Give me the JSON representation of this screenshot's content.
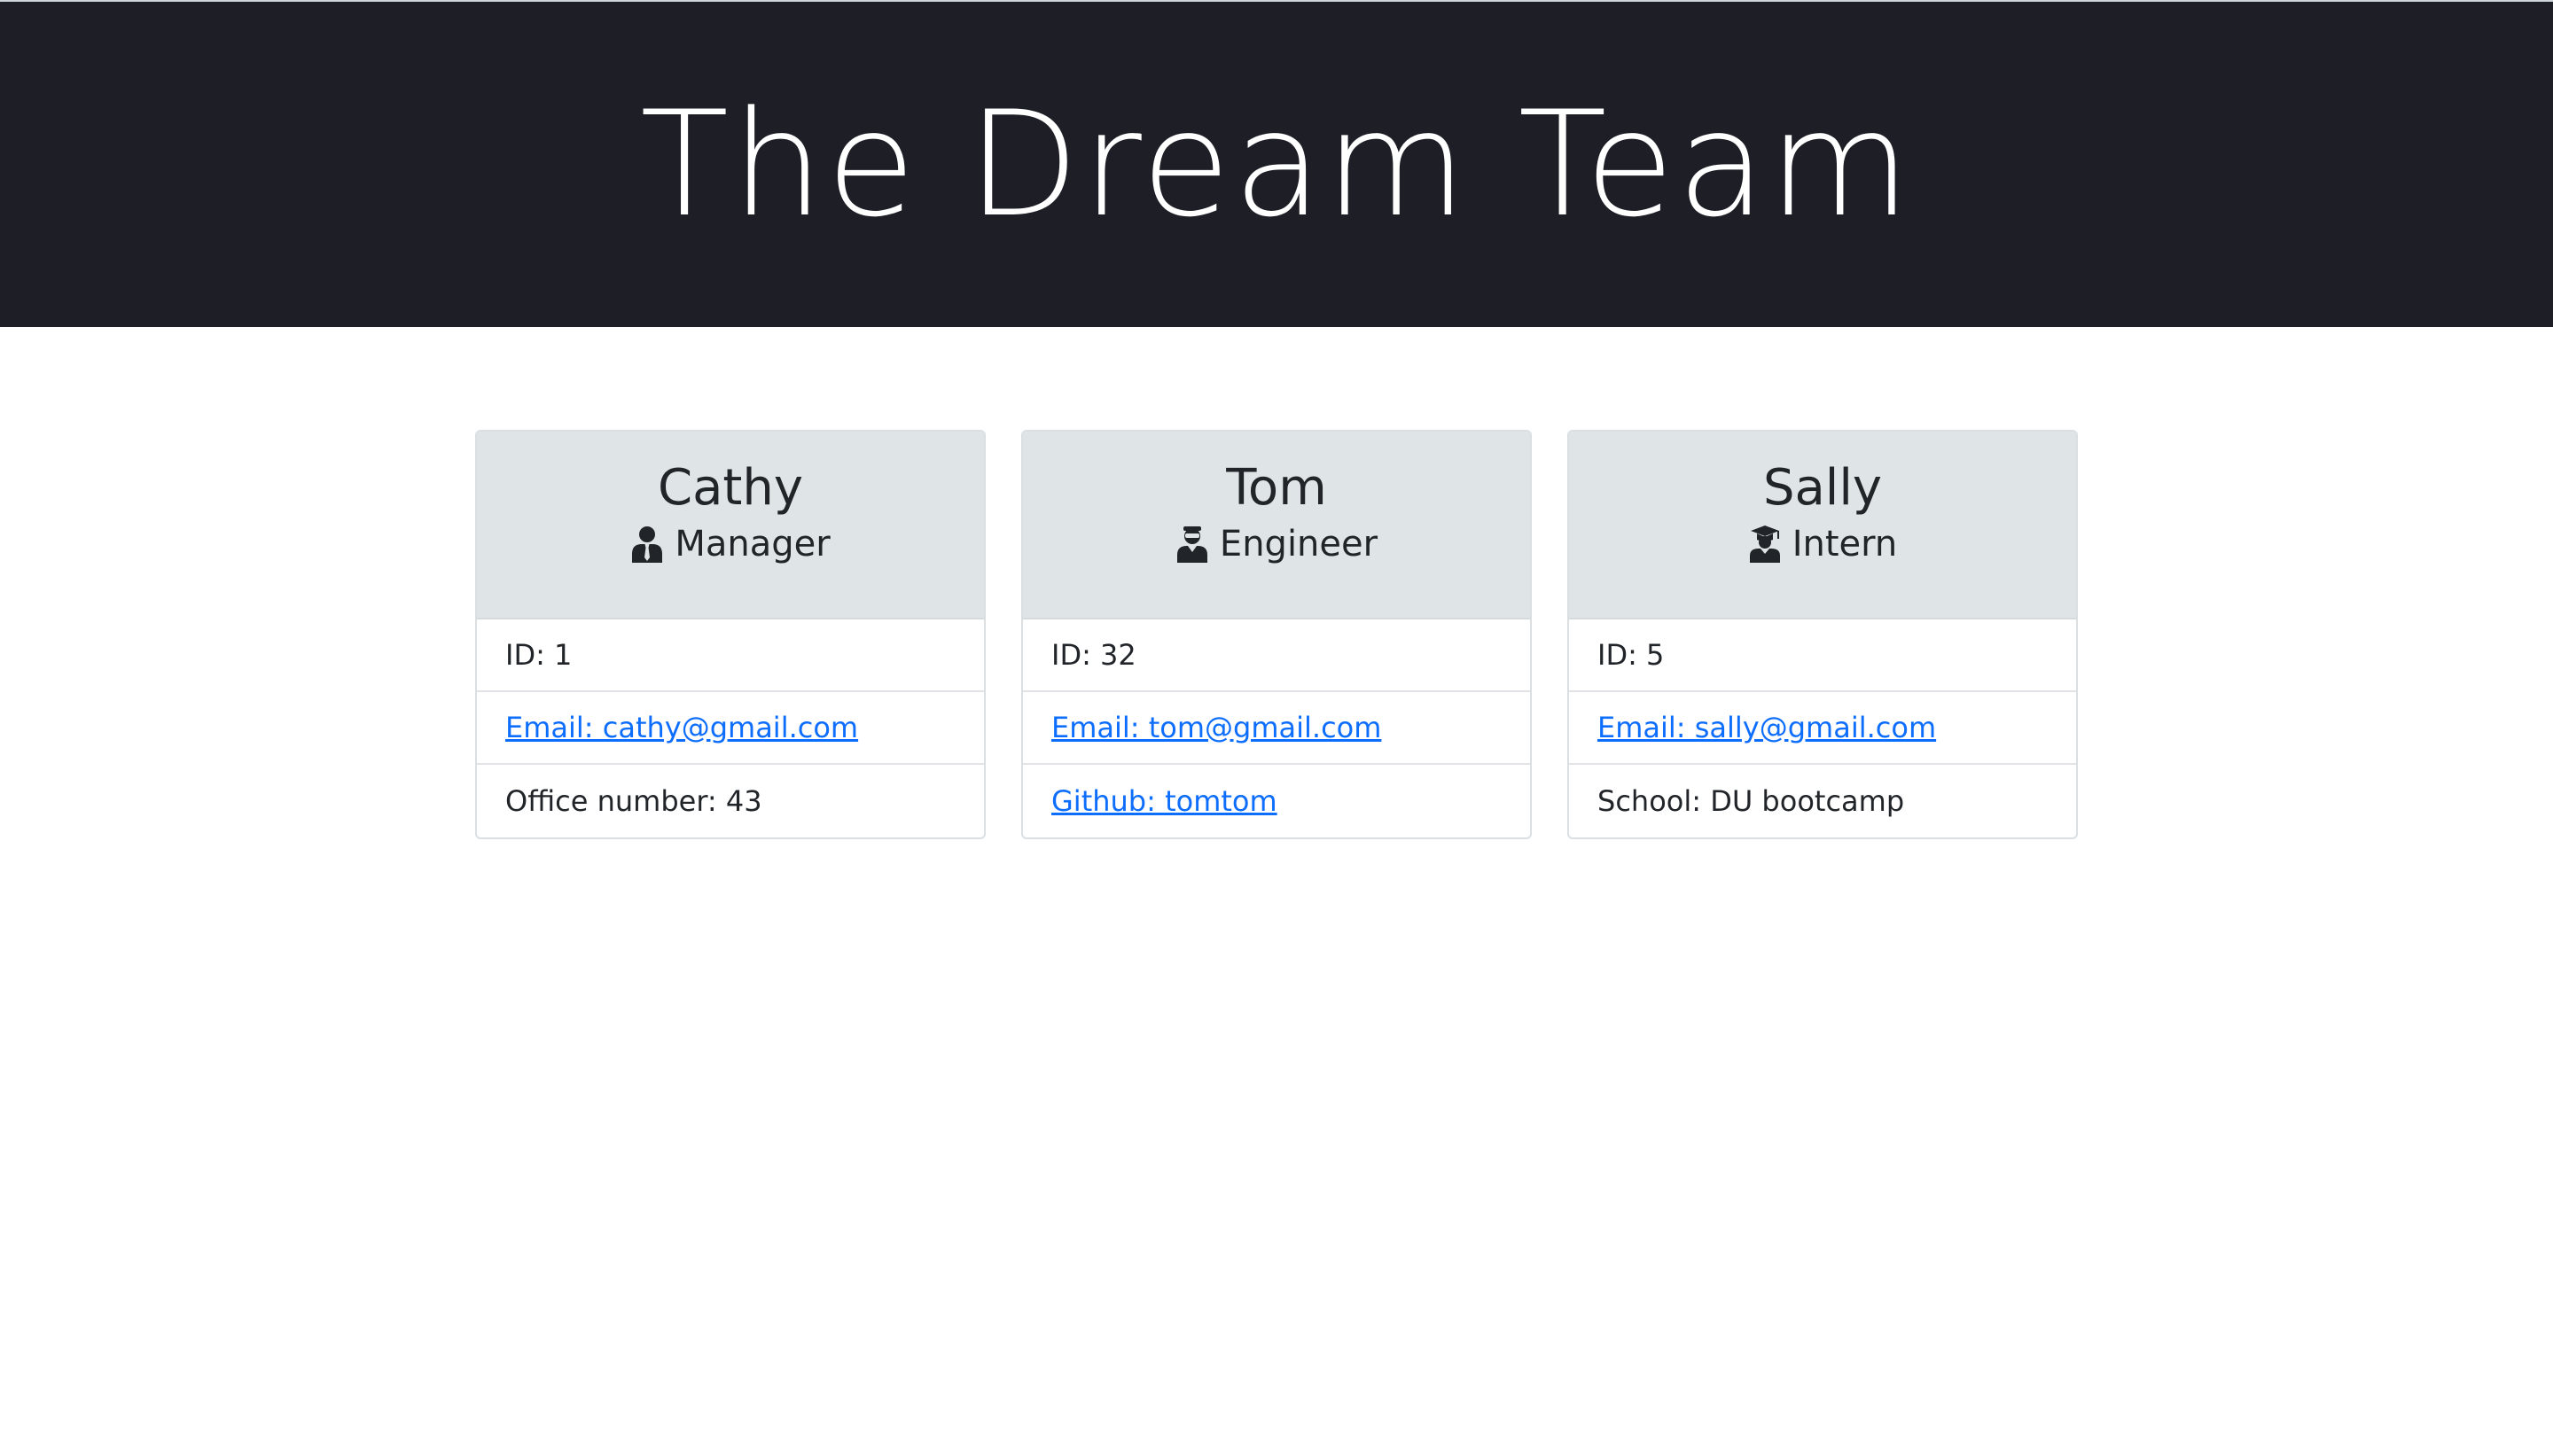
{
  "header": {
    "title": "The Dream Team"
  },
  "team": [
    {
      "name": "Cathy",
      "role": "Manager",
      "role_icon": "manager-icon",
      "id": "ID: 1",
      "email": "Email: cathy@gmail.com",
      "extra": "Office number: 43"
    },
    {
      "name": "Tom",
      "role": "Engineer",
      "role_icon": "engineer-icon",
      "id": "ID: 32",
      "email": "Email: tom@gmail.com",
      "extra": "Github: tomtom"
    },
    {
      "name": "Sally",
      "role": "Intern",
      "role_icon": "intern-icon",
      "id": "ID: 5",
      "email": "Email: sally@gmail.com",
      "extra": "School: DU bootcamp"
    }
  ],
  "colors": {
    "header_bg": "#1e1f26",
    "card_header_bg": "#dfe5e7",
    "link": "#0d6efd",
    "text": "#212529"
  }
}
